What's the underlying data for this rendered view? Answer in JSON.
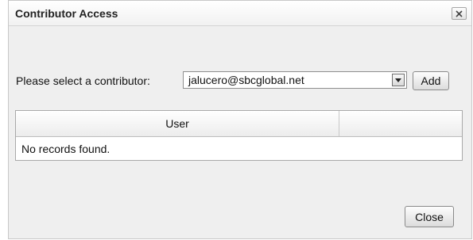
{
  "dialog": {
    "title": "Contributor Access",
    "close_icon": "close-icon"
  },
  "form": {
    "label": "Please select a contributor:",
    "selected_contributor": "jalucero@sbcglobal.net",
    "dropdown_icon": "chevron-down-icon",
    "add_label": "Add"
  },
  "table": {
    "columns": [
      "User",
      ""
    ],
    "empty_message": "No records found."
  },
  "footer": {
    "close_label": "Close"
  }
}
